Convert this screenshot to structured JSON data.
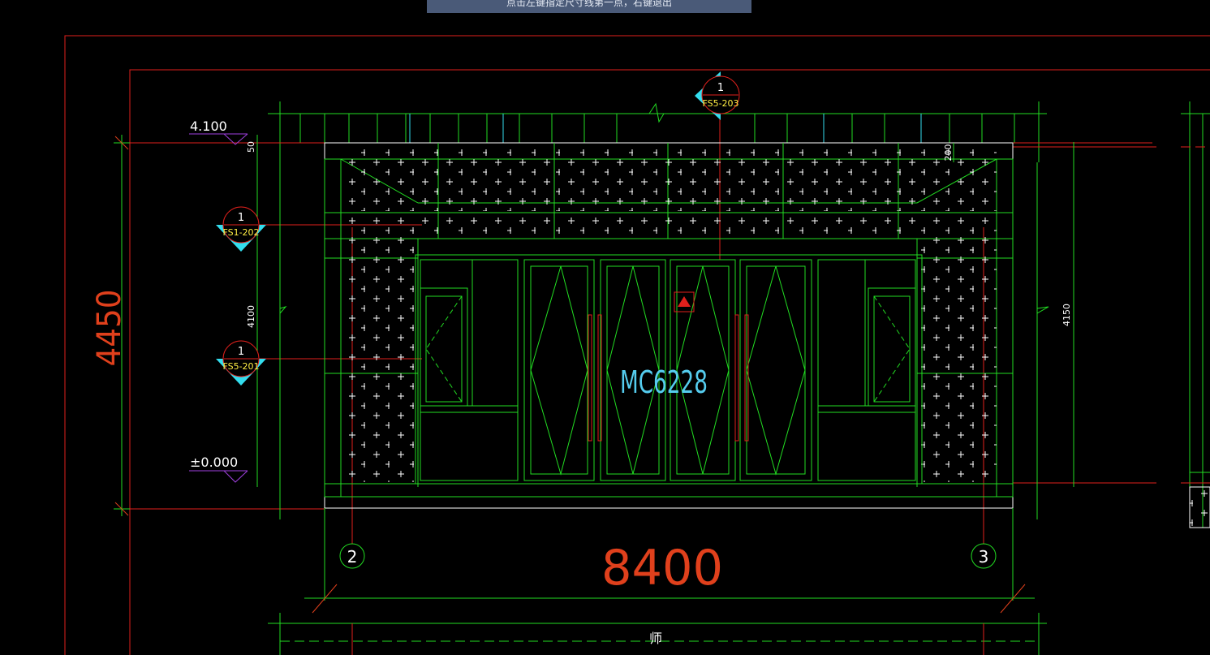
{
  "prompt": {
    "text": "点击左键指定尺寸线第一点，右键退出",
    "bg_color": "#4a5a78"
  },
  "drawing": {
    "big_dim_horizontal": "8400",
    "big_dim_vertical": "4450",
    "door_label": "MC6228",
    "elev_top": "4.100",
    "elev_bottom": "±0.000",
    "dim_left_small_top": "50",
    "dim_left_mid": "4100",
    "dim_right_small_top": "200",
    "dim_right_mid": "4150",
    "grid_left": "2",
    "grid_right": "3",
    "bottom_cut_text": "师",
    "section_marks": [
      {
        "num": "1",
        "ref": "FS5-203"
      },
      {
        "num": "1",
        "ref": "FS1-202"
      },
      {
        "num": "1",
        "ref": "FS5-201"
      }
    ],
    "colors": {
      "frame_red": "#e0201c",
      "dim_orange": "#e0401c",
      "wall_green": "#22dd22",
      "white": "#ffffff",
      "cyan": "#33ddee",
      "label_cyan": "#55ccee",
      "purple": "#a040e0",
      "yellow_text": "#ffee44"
    }
  }
}
